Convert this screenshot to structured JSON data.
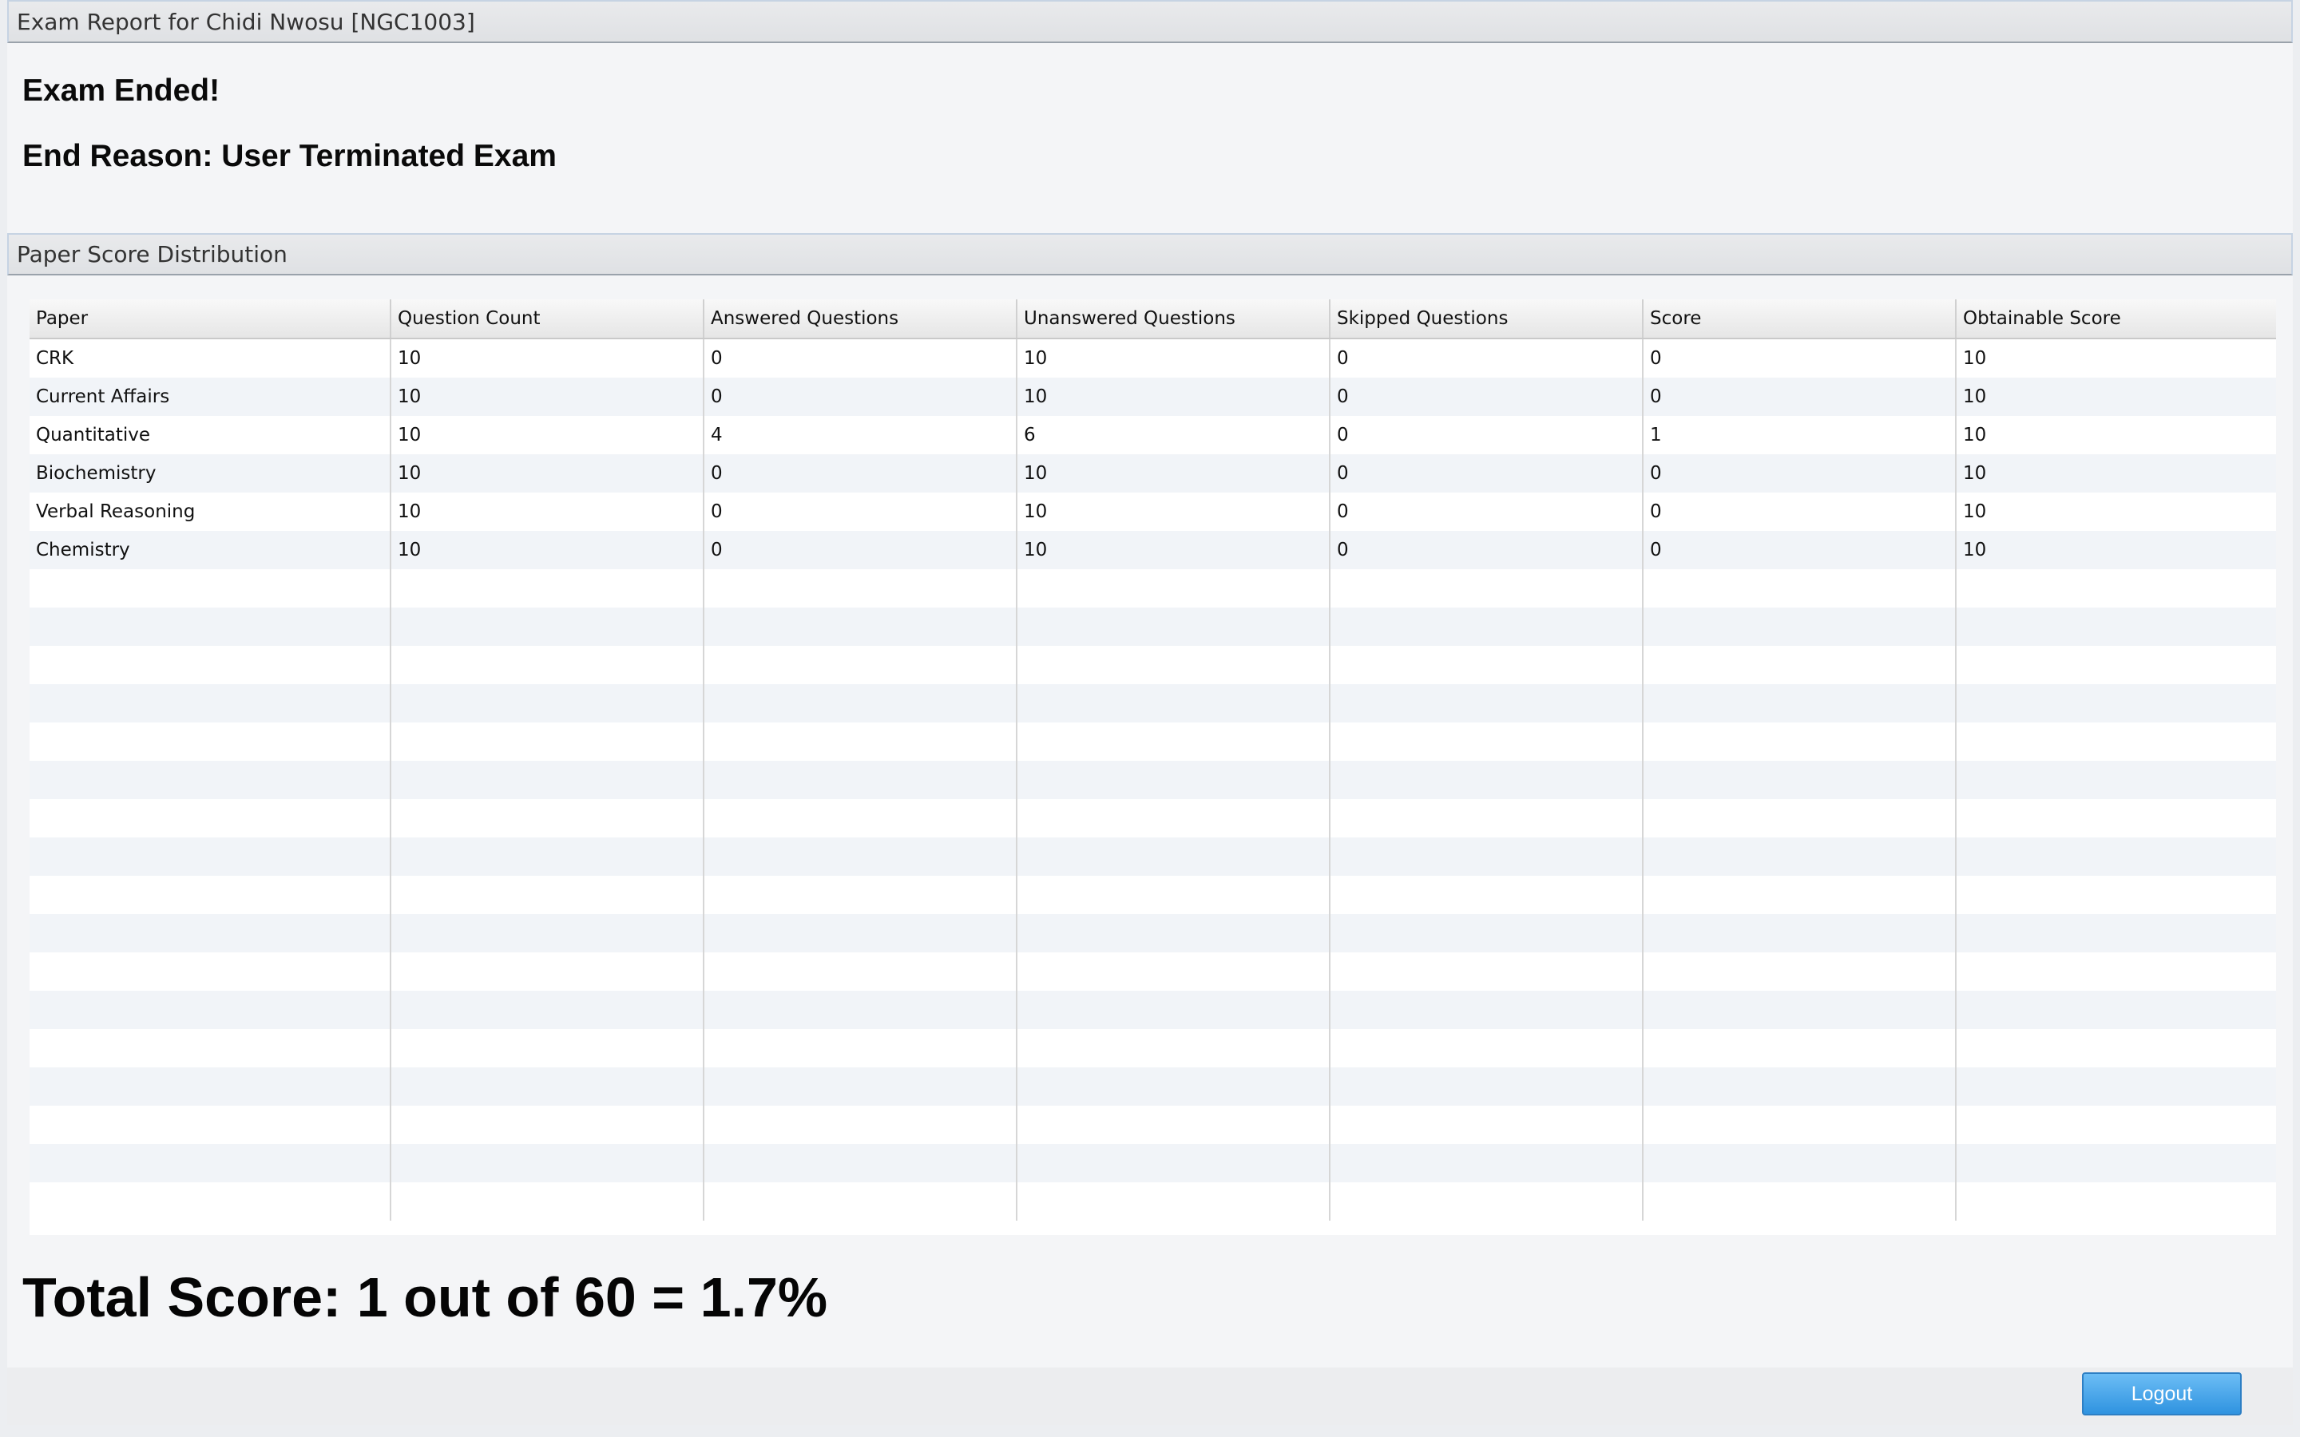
{
  "window": {
    "title": "Exam Report for Chidi Nwosu [NGC1003]"
  },
  "status": {
    "exam_ended": "Exam Ended!",
    "end_reason": "End Reason: User Terminated Exam"
  },
  "paper_section": {
    "title": "Paper Score Distribution",
    "columns": [
      "Paper",
      "Question Count",
      "Answered Questions",
      "Unanswered Questions",
      "Skipped Questions",
      "Score",
      "Obtainable Score"
    ],
    "rows": [
      [
        "CRK",
        "10",
        "0",
        "10",
        "0",
        "0",
        "10"
      ],
      [
        "Current Affairs",
        "10",
        "0",
        "10",
        "0",
        "0",
        "10"
      ],
      [
        "Quantitative",
        "10",
        "4",
        "6",
        "0",
        "1",
        "10"
      ],
      [
        "Biochemistry",
        "10",
        "0",
        "10",
        "0",
        "0",
        "10"
      ],
      [
        "Verbal Reasoning",
        "10",
        "0",
        "10",
        "0",
        "0",
        "10"
      ],
      [
        "Chemistry",
        "10",
        "0",
        "10",
        "0",
        "0",
        "10"
      ]
    ]
  },
  "total": {
    "text": "Total Score: 1 out of 60 = 1.7%"
  },
  "footer": {
    "logout_label": "Logout"
  }
}
